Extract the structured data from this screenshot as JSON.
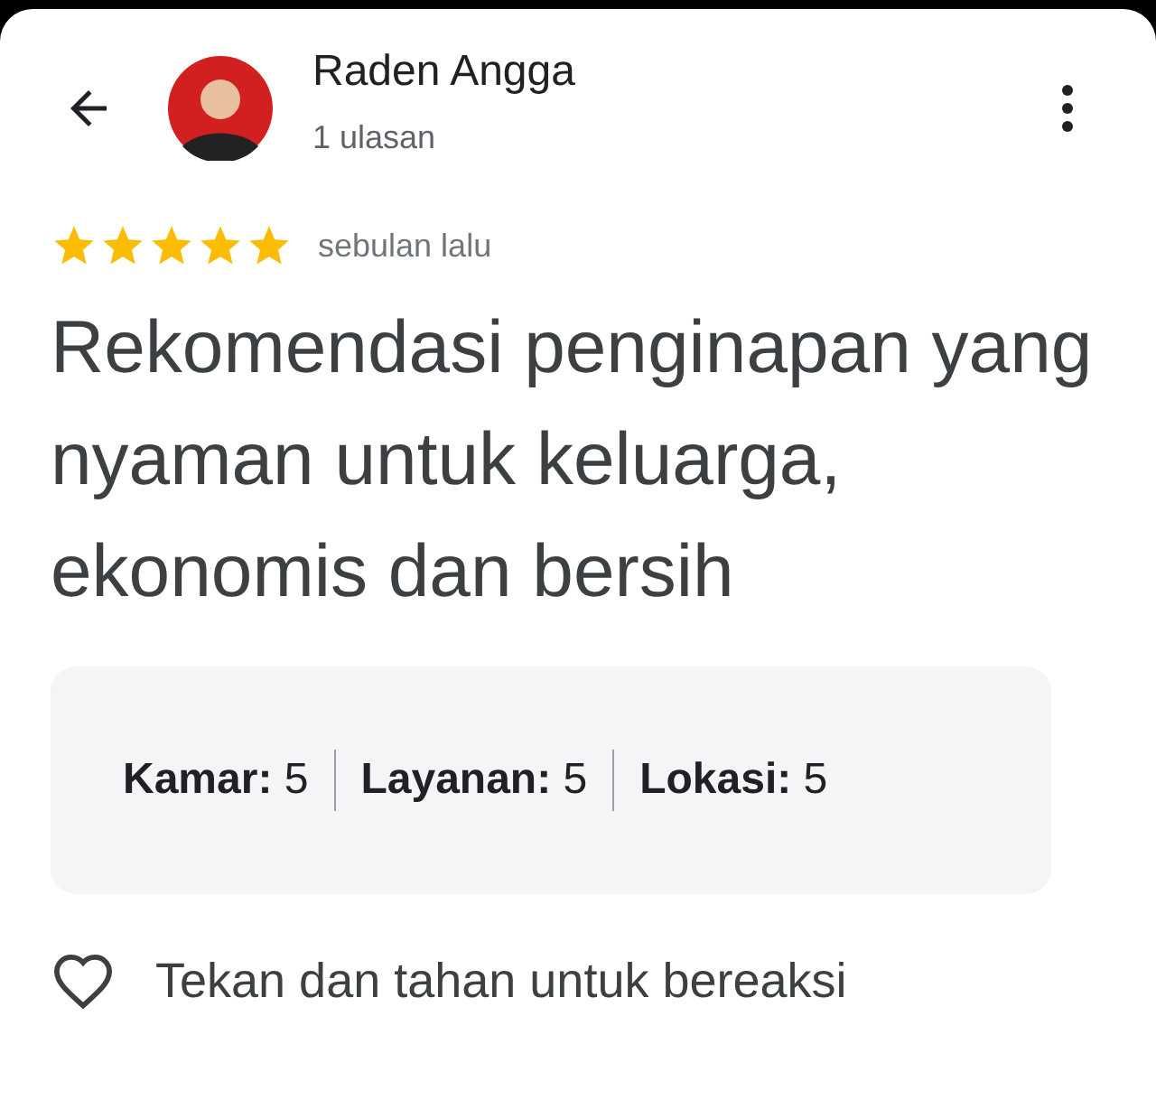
{
  "reviewer": {
    "name": "Raden Angga",
    "review_count": "1 ulasan"
  },
  "review": {
    "stars": 5,
    "time": "sebulan lalu",
    "text": "Rekomendasi penginapan yang nyaman untuk keluarga, ekonomis dan bersih"
  },
  "ratings": [
    "**Kamar:** 5",
    "**Layanan:** 5",
    "**Lokasi:** 5"
  ],
  "reaction": {
    "label": "Tekan dan tahan untuk bereaksi"
  }
}
